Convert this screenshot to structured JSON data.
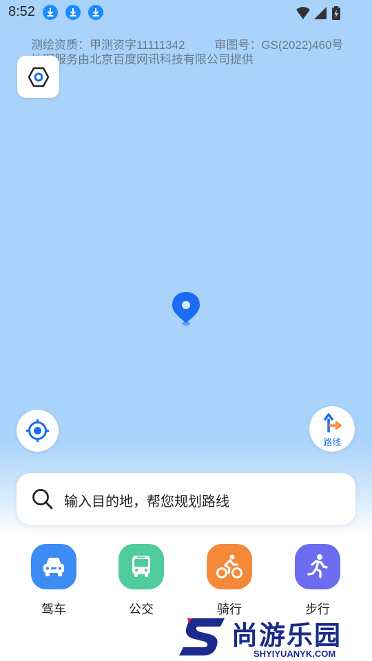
{
  "status_bar": {
    "time": "8:52",
    "download_icons": [
      "download-icon",
      "download-icon",
      "download-icon"
    ],
    "system_icons": [
      "wifi-icon",
      "signal-icon",
      "battery-charging-icon"
    ]
  },
  "map": {
    "notice_line1_part1": "测绘资质：甲测资字11111342",
    "notice_line1_part2": "审图号：GS(2022)460号",
    "notice_line2": "地图服务由北京百度网讯科技有限公司提供",
    "background_color": "#a9d3fb",
    "pin_color": "#1a6cf0"
  },
  "controls": {
    "layer_icon": "hexagon-layer-icon",
    "locate_icon": "locate-crosshair-icon",
    "route_label": "路线",
    "route_icon": "route-turn-icon"
  },
  "search": {
    "placeholder": "输入目的地，帮您规划路线",
    "icon": "search-icon"
  },
  "modes": [
    {
      "label": "驾车",
      "icon": "car-icon",
      "color": "#3b8cf5"
    },
    {
      "label": "公交",
      "icon": "bus-icon",
      "color": "#4fcb9c"
    },
    {
      "label": "骑行",
      "icon": "bike-icon",
      "color": "#f5893b"
    },
    {
      "label": "步行",
      "icon": "walk-icon",
      "color": "#6b6cf0"
    }
  ],
  "watermark": {
    "title": "尚游乐园",
    "subtitle": "SHYIYUANYK.COM"
  }
}
